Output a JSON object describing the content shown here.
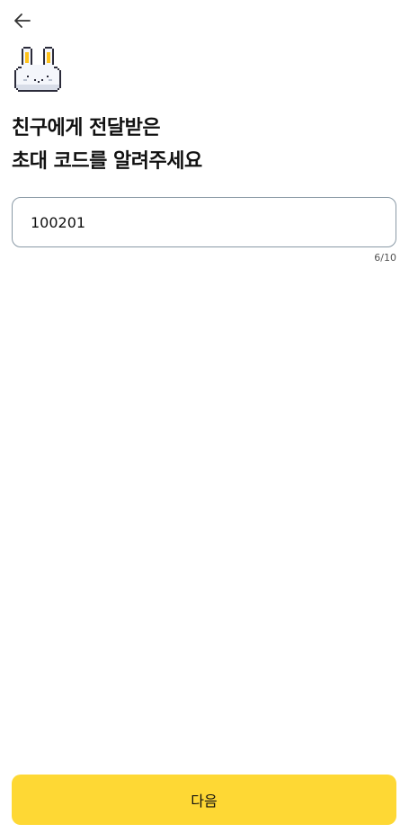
{
  "header": {
    "back_icon": "arrow-left-icon"
  },
  "mascot": {
    "icon": "pixel-bunny-icon",
    "accent_color": "#FFC21A"
  },
  "title": {
    "line1": "친구에게 전달받은",
    "line2": "초대 코드를 알려주세요"
  },
  "invite_code": {
    "value": "100201",
    "counter": "6/10"
  },
  "footer": {
    "next_label": "다음",
    "button_color": "#FED834"
  }
}
